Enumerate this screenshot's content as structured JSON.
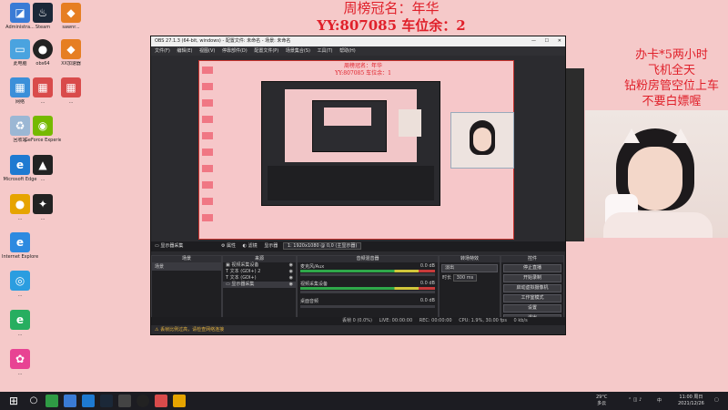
{
  "overlay": {
    "top_line1": "周榜冠名：年华",
    "top_line2": "YY:807085  车位余：2",
    "right_lines": [
      "办卡*5两小时",
      "飞机全天",
      "钻粉房管空位上车",
      "不要白嫖喔"
    ]
  },
  "desktop_icons": [
    {
      "label": "Administra..."
    },
    {
      "label": "Steam"
    },
    {
      "label": "sawnr..."
    },
    {
      "label": "此电脑"
    },
    {
      "label": "obs64"
    },
    {
      "label": "XX加速器"
    },
    {
      "label": "网络"
    },
    {
      "label": "..."
    },
    {
      "label": "..."
    },
    {
      "label": "回收站"
    },
    {
      "label": "GeForce Experience"
    },
    {
      "label": "Microsoft Edge"
    },
    {
      "label": "..."
    },
    {
      "label": "..."
    },
    {
      "label": "..."
    },
    {
      "label": "Internet Explorer"
    },
    {
      "label": "..."
    },
    {
      "label": "..."
    },
    {
      "label": "..."
    }
  ],
  "obs": {
    "title": "OBS 27.1.3 (64-bit, windows) - 配置文件: 未命名 - 场景: 未命名",
    "menu": [
      "文件(F)",
      "编辑(E)",
      "视图(V)",
      "停靠部件(D)",
      "配置文件(P)",
      "场景集合(S)",
      "工具(T)",
      "帮助(H)"
    ],
    "preview_overlay_line1": "周榜冠名：年华",
    "preview_overlay_line2": "YY:807085  车位余：1",
    "source_bar": {
      "label": "显示器采集",
      "props": "属性",
      "filters": "滤镜",
      "display": "显示器",
      "display_value": "1: 1920x1080 @ 0,0 (主显示器)"
    },
    "docks": {
      "scenes_header": "场景",
      "scenes": [
        "场景"
      ],
      "sources_header": "来源",
      "sources": [
        "视频采集设备",
        "文本 (GDI+) 2",
        "文本 (GDI+)",
        "显示器采集"
      ],
      "mixer_header": "音频混音器",
      "mixer": [
        {
          "name": "麦克风/Aux",
          "db": "0.0 dB"
        },
        {
          "name": "视频采集设备",
          "db": "0.0 dB"
        },
        {
          "name": "桌面音频",
          "db": "0.0 dB"
        }
      ],
      "transitions_header": "转场特效",
      "transition": "淡出",
      "duration_label": "时长",
      "duration_value": "300 ms",
      "controls_header": "控件",
      "controls": [
        "停止直播",
        "开始录制",
        "启动虚拟摄像机",
        "工作室模式",
        "设置",
        "退出"
      ]
    },
    "status": {
      "dropped": "丢帧 0 (0.0%)",
      "live": "LIVE: 00:00:00",
      "rec": "REC: 00:00:00",
      "cpu": "CPU: 1.9%, 30.00 fps",
      "kbps": "0 kb/s"
    },
    "notice": "丢帧比例过高，请检查网络连接"
  },
  "taskbar": {
    "weather": "29°C",
    "weather_desc": "多云",
    "time": "11:00 周日",
    "date": "2021/12/26",
    "lang": "中"
  },
  "colors": {
    "accent": "#e0202a",
    "desktop_bg": "#f5c9c9",
    "obs_bg": "#2b2b2f"
  }
}
